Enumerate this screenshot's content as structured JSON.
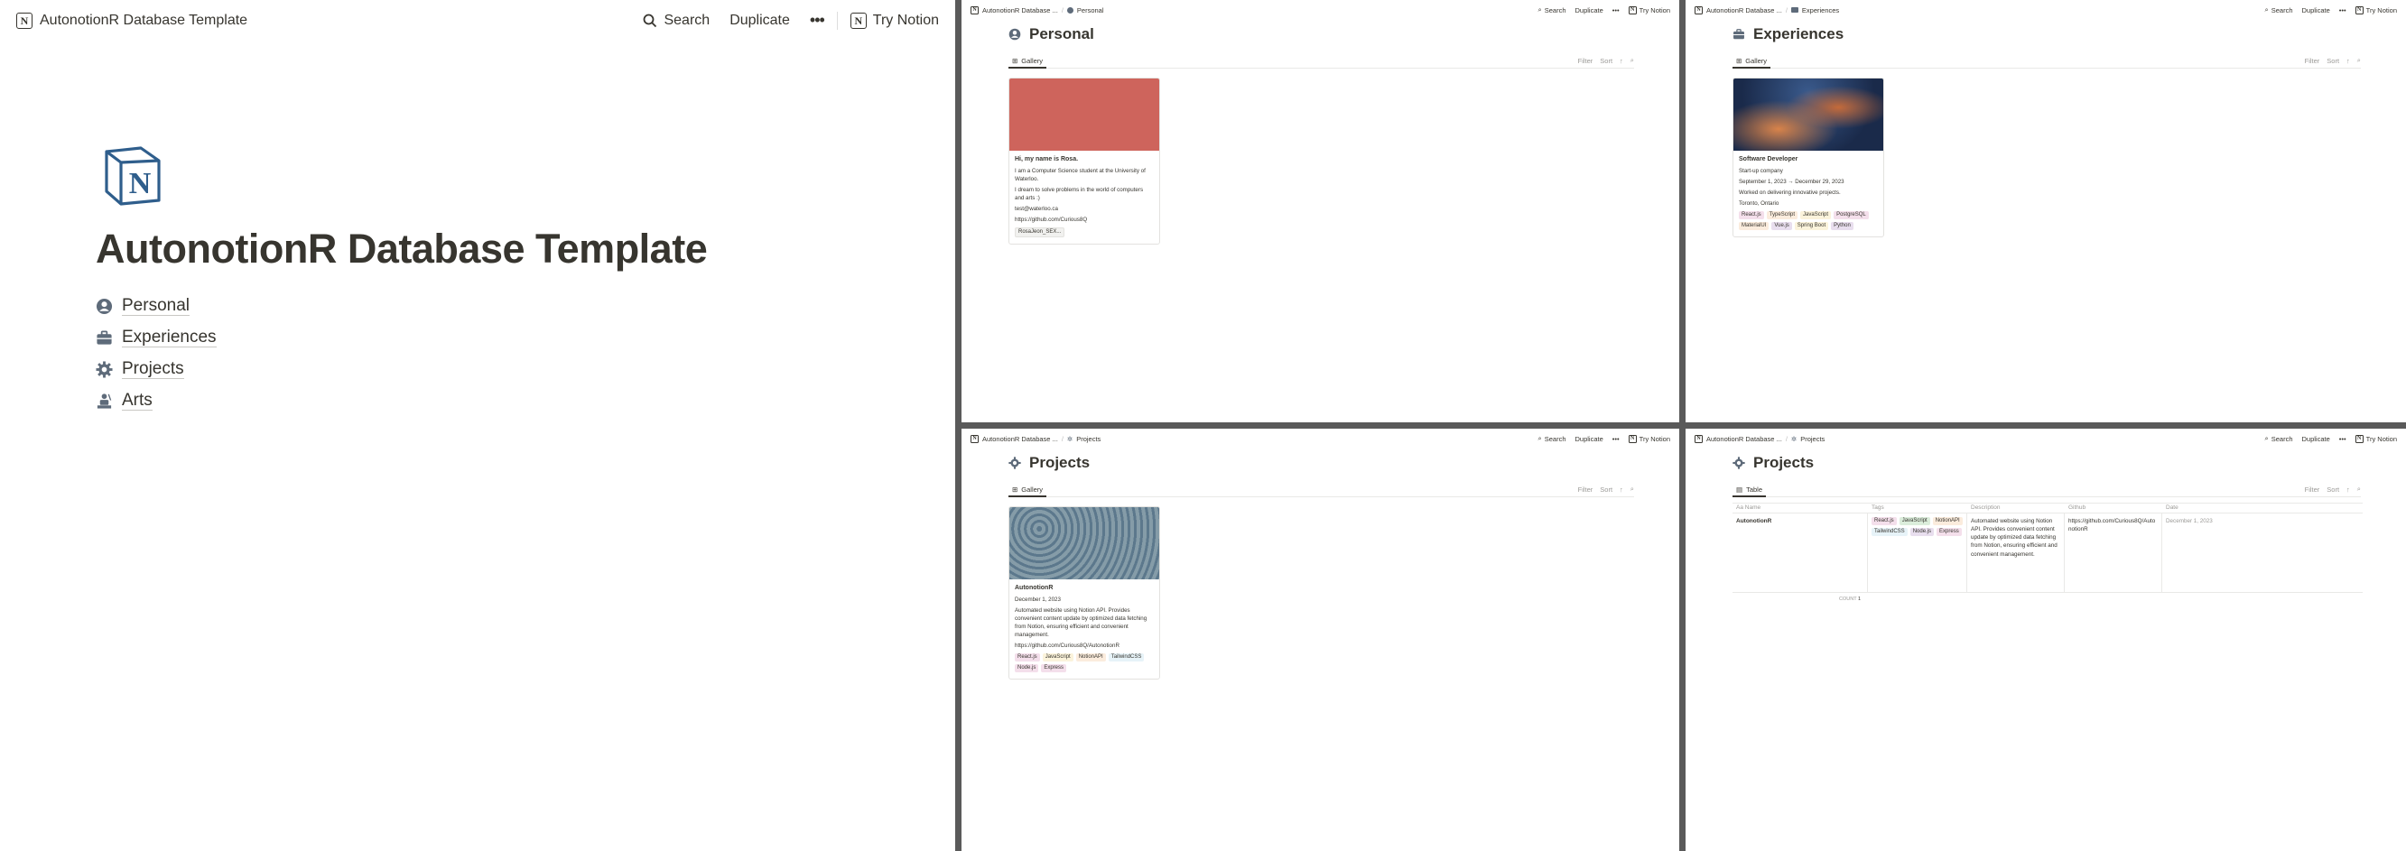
{
  "main": {
    "breadcrumb": "AutonotionR Database Template",
    "search_label": "Search",
    "duplicate_label": "Duplicate",
    "more_label": "•••",
    "try_notion_label": "Try Notion",
    "title": "AutonotionR Database Template",
    "links": [
      {
        "label": "Personal",
        "icon": "user-circle-icon"
      },
      {
        "label": "Experiences",
        "icon": "briefcase-icon"
      },
      {
        "label": "Projects",
        "icon": "gear-icon"
      },
      {
        "label": "Arts",
        "icon": "painter-icon"
      }
    ]
  },
  "panels": {
    "common": {
      "crumb_root": "AutonotionR Database ...",
      "search": "Search",
      "duplicate": "Duplicate",
      "more": "•••",
      "try_notion": "Try Notion",
      "filter": "Filter",
      "sort": "Sort",
      "arrow": "↑",
      "search_glyph": "⌕"
    },
    "personal": {
      "crumb": "Personal",
      "title": "Personal",
      "tab": "Gallery",
      "card": {
        "image_color": "#ce645c",
        "title": "Hi, my name is Rosa.",
        "line1": "I am a Computer Science student at the University of Waterloo.",
        "line2": "I dream to solve problems in the world of computers and arts :)",
        "email": "test@waterloo.ca",
        "github": "https://github.com/Curious8Q",
        "file": "RosaJeon_SEX..."
      }
    },
    "experiences": {
      "crumb": "Experiences",
      "title": "Experiences",
      "tab": "Gallery",
      "card": {
        "title": "Software Developer",
        "company": "Start-up company",
        "dates": "September 1, 2023 → December 29, 2023",
        "summary": "Worked on delivering innovative projects.",
        "location": "Toronto, Ontario",
        "tags": [
          {
            "label": "React.js",
            "bg": "#f4dfeb"
          },
          {
            "label": "TypeScript",
            "bg": "#fbecdd"
          },
          {
            "label": "JavaScript",
            "bg": "#fbf3db"
          },
          {
            "label": "PostgreSQL",
            "bg": "#f4dfeb"
          },
          {
            "label": "MaterialUI",
            "bg": "#fbecdd"
          },
          {
            "label": "Vue.js",
            "bg": "#e8deee"
          },
          {
            "label": "Spring Boot",
            "bg": "#fbf3db"
          },
          {
            "label": "Python",
            "bg": "#e8deee"
          }
        ]
      }
    },
    "projects_gallery": {
      "crumb": "Projects",
      "title": "Projects",
      "tab": "Gallery",
      "card": {
        "title": "AutonotionR",
        "date": "December 1, 2023",
        "desc": "Automated website using Notion API. Provides convenient content update by optimized data fetching from Notion, ensuring efficient and convenient management.",
        "github": "https://github.com/Curious8Q/AutonotionR",
        "tags": [
          {
            "label": "React.js",
            "bg": "#f4dfeb"
          },
          {
            "label": "JavaScript",
            "bg": "#fbf3db"
          },
          {
            "label": "NotionAPI",
            "bg": "#fbecdd"
          },
          {
            "label": "TailwindCSS",
            "bg": "#e7f3f8"
          },
          {
            "label": "Node.js",
            "bg": "#f4dfeb"
          },
          {
            "label": "Express",
            "bg": "#f4dfeb"
          }
        ]
      }
    },
    "projects_table": {
      "crumb": "Projects",
      "title": "Projects",
      "tab": "Table",
      "columns": [
        "Aa Name",
        "Tags",
        "Description",
        "Github",
        "Date"
      ],
      "row": {
        "name": "AutonotionR",
        "tags": [
          {
            "label": "React.js",
            "bg": "#f4dfeb"
          },
          {
            "label": "JavaScript",
            "bg": "#dbeddb"
          },
          {
            "label": "NotionAPI",
            "bg": "#fbecdd"
          },
          {
            "label": "TailwindCSS",
            "bg": "#e7f3f8"
          },
          {
            "label": "Node.js",
            "bg": "#e8deee"
          },
          {
            "label": "Express",
            "bg": "#f4dfeb"
          }
        ],
        "description": "Automated website using Notion API. Provides convenient content update by optimized data fetching from Notion, ensuring efficient and convenient management.",
        "github": "https://github.com/Curious8Q/AutonotionR",
        "date": "December 1, 2023"
      },
      "count_label": "COUNT",
      "count": "1"
    }
  }
}
